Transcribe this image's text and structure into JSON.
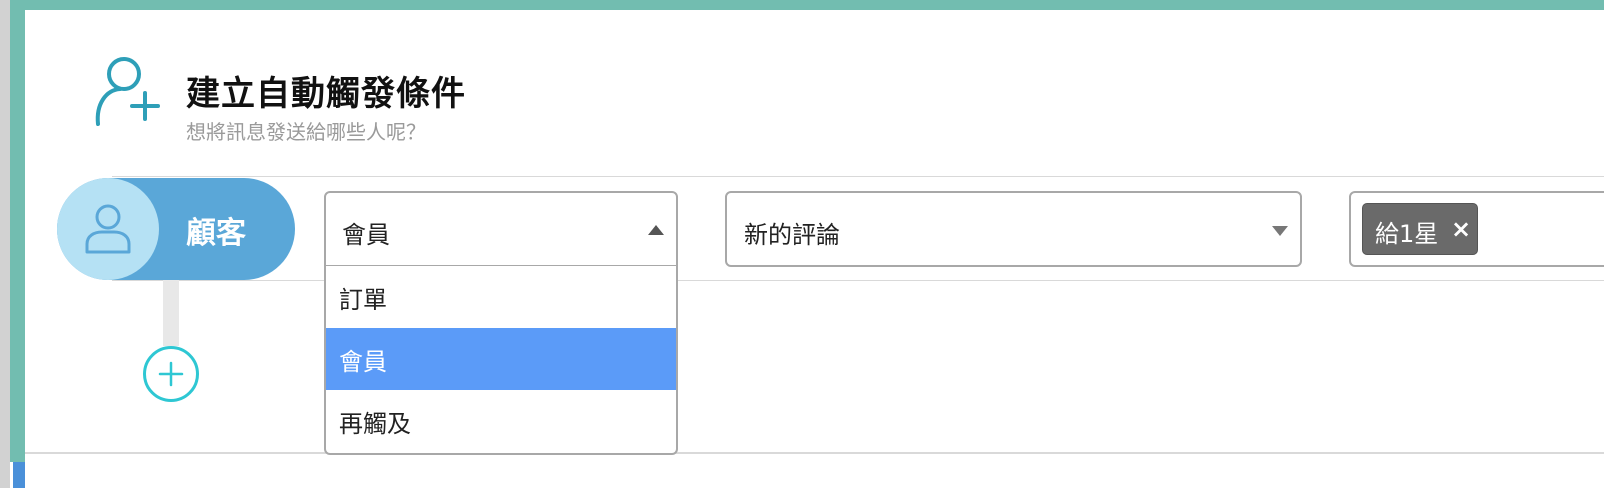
{
  "header": {
    "icon": "add-user-icon",
    "title": "建立自動觸發條件",
    "subtitle": "想將訊息發送給哪些人呢？"
  },
  "audience": {
    "icon": "user-icon",
    "label": "顧客"
  },
  "add_condition": {
    "icon": "plus-icon"
  },
  "condition": {
    "type_select": {
      "value": "會員",
      "expanded": true,
      "options": [
        {
          "label": "訂單",
          "selected": false
        },
        {
          "label": "會員",
          "selected": true
        },
        {
          "label": "再觸及",
          "selected": false
        }
      ]
    },
    "event_select": {
      "value": "新的評論"
    },
    "filter_tags": [
      {
        "label": "給1星",
        "remove_icon": "×"
      }
    ]
  },
  "colors": {
    "frame_teal": "#72bdb0",
    "pill_blue": "#5aa7d8",
    "pill_light": "#b5e1f4",
    "add_button_cyan": "#2ec7d3",
    "option_selected": "#5b9bf8",
    "tag_gray": "#6a6a6a"
  }
}
